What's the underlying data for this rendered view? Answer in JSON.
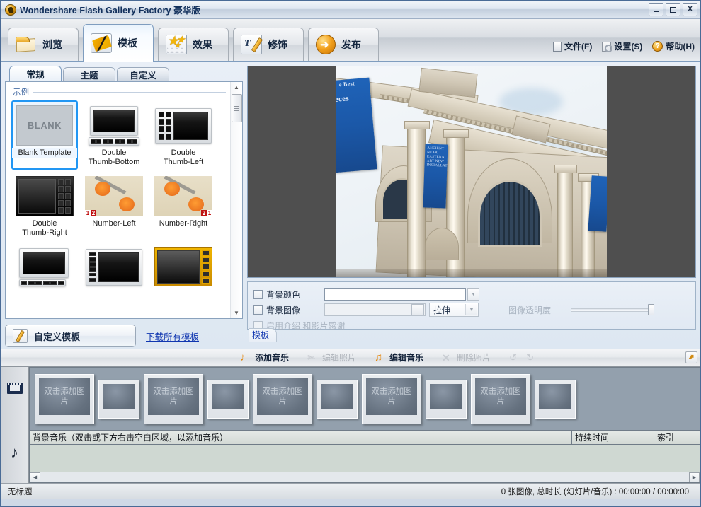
{
  "window": {
    "title": "Wondershare Flash Gallery Factory 豪华版",
    "minimize_label": "",
    "maximize_label": "",
    "close_label": "X"
  },
  "toolbar": {
    "tabs": [
      {
        "label": "浏览",
        "icon": "folder-icon",
        "active": false
      },
      {
        "label": "模板",
        "icon": "film-template-icon",
        "active": true
      },
      {
        "label": "效果",
        "icon": "stars-effect-icon",
        "active": false
      },
      {
        "label": "修饰",
        "icon": "text-pencil-decorate-icon",
        "active": false
      },
      {
        "label": "发布",
        "icon": "publish-arrow-icon",
        "active": false
      }
    ],
    "menu": [
      {
        "label": "文件(F)",
        "accel": "F",
        "icon": "document-icon"
      },
      {
        "label": "设置(S)",
        "accel": "S",
        "icon": "gear-icon"
      },
      {
        "label": "帮助(H)",
        "accel": "H",
        "icon": "help-question-icon"
      }
    ]
  },
  "left_panel": {
    "tabs": [
      {
        "label": "常规",
        "active": true
      },
      {
        "label": "主题",
        "active": false
      },
      {
        "label": "自定义",
        "active": false
      }
    ],
    "group_label": "示例",
    "templates": [
      {
        "name": "Blank Template",
        "art": "blank",
        "selected": true
      },
      {
        "name": "Double\nThumb-Bottom",
        "art": "thumb-bottom",
        "selected": false
      },
      {
        "name": "Double\nThumb-Left",
        "art": "thumb-left",
        "selected": false
      },
      {
        "name": "Double\nThumb-Right",
        "art": "thumb-right",
        "selected": false
      },
      {
        "name": "Number-Left",
        "art": "number-left",
        "selected": false
      },
      {
        "name": "Number-Right",
        "art": "number-right",
        "selected": false
      },
      {
        "name": "",
        "art": "thumb-bottom2",
        "selected": false
      },
      {
        "name": "",
        "art": "thumb-left2",
        "selected": false
      },
      {
        "name": "",
        "art": "gold-frame",
        "selected": false
      }
    ],
    "blank_art_text": "BLANK",
    "custom_template_button": "自定义模板",
    "download_link": "下载所有模板"
  },
  "preview": {
    "background_color_label": "背景颜色",
    "background_color_value": "#000000",
    "background_image_label": "背景图像",
    "background_image_value": "",
    "background_image_browse": "···",
    "stretch_mode": "拉伸",
    "enable_intro_label": "启用介绍 和影片感谢",
    "transparency_label": "图像透明度",
    "transparency_value": 100,
    "panel_tab": "模板",
    "photo_banner_1_line1": "e Best",
    "photo_banner_1_line2": "eces",
    "photo_banner_2": "ANCIENT NEAR EASTERN ART  NEW INSTALLATION"
  },
  "media_toolbar": {
    "items": [
      {
        "label": "添加音乐",
        "icon": "add-music-note-icon",
        "enabled": true
      },
      {
        "label": "编辑照片",
        "icon": "edit-photo-scissors-icon",
        "enabled": false
      },
      {
        "label": "编辑音乐",
        "icon": "edit-music-note-icon",
        "enabled": true
      },
      {
        "label": "删除照片",
        "icon": "delete-photo-x-icon",
        "enabled": false
      }
    ],
    "rotate_left_icon": "rotate-left-icon",
    "rotate_right_icon": "rotate-right-icon",
    "expand_icon": "expand-panel-icon"
  },
  "timeline": {
    "photo_track_icon": "filmstrip-icon",
    "music_track_icon": "music-note-icon",
    "placeholder_text": "双击添加图片",
    "slots": [
      {
        "size": "big",
        "label": "双击添加图片"
      },
      {
        "size": "small",
        "label": ""
      },
      {
        "size": "big",
        "label": "双击添加图片"
      },
      {
        "size": "small",
        "label": ""
      },
      {
        "size": "big",
        "label": "双击添加图片"
      },
      {
        "size": "small",
        "label": ""
      },
      {
        "size": "big",
        "label": "双击添加图片"
      },
      {
        "size": "small",
        "label": ""
      },
      {
        "size": "big",
        "label": "双击添加图片"
      },
      {
        "size": "small",
        "label": ""
      }
    ],
    "music_columns": [
      "背景音乐（双击或下方右击空白区域，以添加音乐）",
      "持续时间",
      "索引"
    ]
  },
  "status_bar": {
    "left": "无标题",
    "right": "0 张图像, 总时长 (幻灯片/音乐) : 00:00:00 / 00:00:00"
  }
}
